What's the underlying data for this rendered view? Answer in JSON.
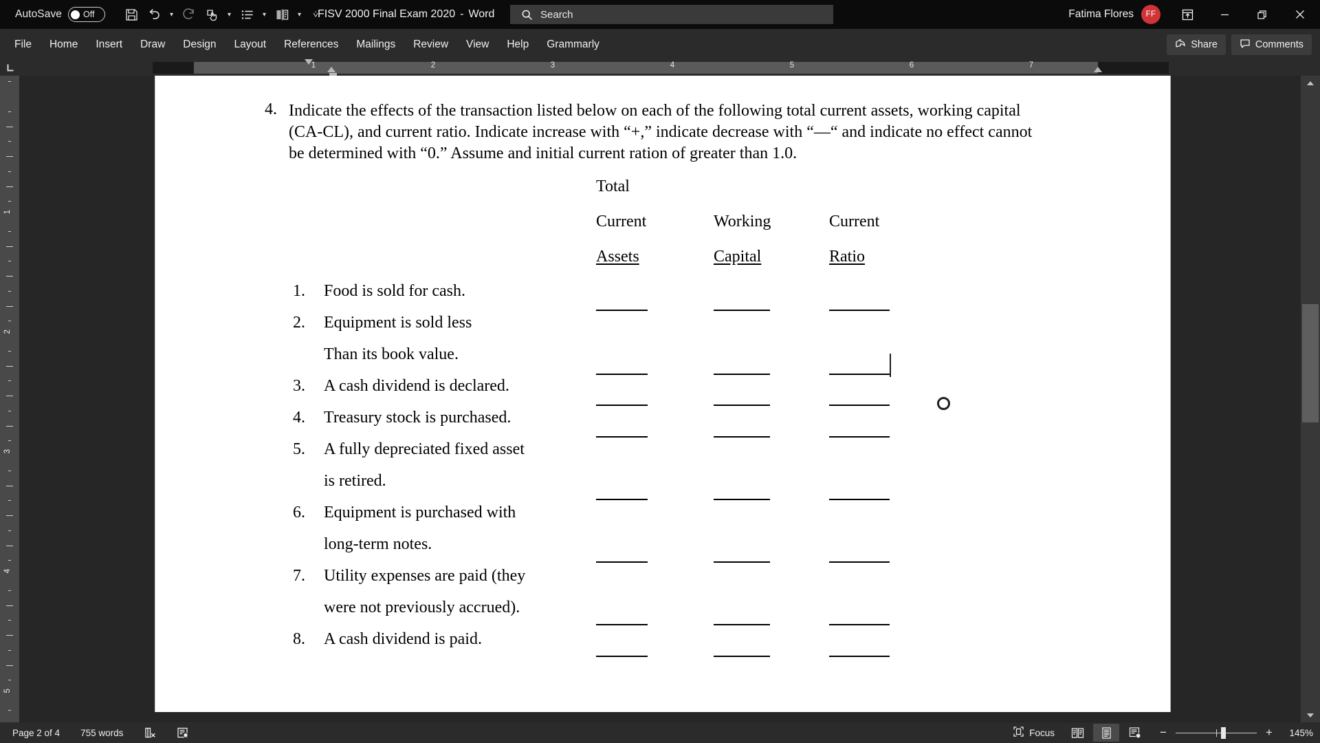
{
  "titlebar": {
    "autosave_label": "AutoSave",
    "autosave_state": "Off",
    "document_title": "FISV 2000 Final Exam 2020",
    "title_separator": "-",
    "app_name": "Word",
    "search_placeholder": "Search",
    "account_name": "Fatima Flores",
    "account_initials": "FF",
    "quick_access": [
      {
        "name": "save-icon",
        "label": "Save"
      },
      {
        "name": "undo-icon",
        "label": "Undo"
      },
      {
        "name": "redo-icon",
        "label": "Redo"
      },
      {
        "name": "touch-mode-icon",
        "label": "Touch/Mouse Mode"
      },
      {
        "name": "bullet-list-icon",
        "label": "Bullets"
      },
      {
        "name": "compare-icon",
        "label": "Compare"
      },
      {
        "name": "customize-qat-icon",
        "label": "Customize Quick Access Toolbar"
      }
    ],
    "window_controls": [
      {
        "name": "ribbon-display-options-icon",
        "label": "Ribbon Display Options"
      },
      {
        "name": "minimize-icon",
        "label": "Minimize"
      },
      {
        "name": "restore-icon",
        "label": "Restore Down"
      },
      {
        "name": "close-icon",
        "label": "Close"
      }
    ]
  },
  "ribbon": {
    "tabs": [
      "File",
      "Home",
      "Insert",
      "Draw",
      "Design",
      "Layout",
      "References",
      "Mailings",
      "Review",
      "View",
      "Help",
      "Grammarly"
    ],
    "share_label": "Share",
    "comments_label": "Comments"
  },
  "ruler": {
    "horizontal_numbers": [
      "1",
      "1",
      "2",
      "3",
      "4",
      "5",
      "6",
      "7"
    ],
    "vertical_numbers": [
      "1",
      "2",
      "3",
      "4",
      "5"
    ]
  },
  "document": {
    "question_number": "4.",
    "question_text": "Indicate the effects of the transaction listed below on each of the following total current assets, working capital (CA-CL), and current ratio. Indicate increase with “+,” indicate decrease with “—“ and indicate no effect cannot be determined with “0.” Assume and initial current ration of greater than 1.0.",
    "column_headers": [
      {
        "line1": "Total",
        "line2": "Current",
        "line3": "Assets"
      },
      {
        "line1": "",
        "line2": "Working",
        "line3": "Capital"
      },
      {
        "line1": "",
        "line2": "Current",
        "line3": "Ratio"
      }
    ],
    "items": [
      {
        "num": "1.",
        "lines": [
          "Food is sold for cash."
        ]
      },
      {
        "num": "2.",
        "lines": [
          "Equipment is sold less",
          "Than its book value."
        ]
      },
      {
        "num": "3.",
        "lines": [
          "A cash dividend is declared."
        ]
      },
      {
        "num": "4.",
        "lines": [
          "Treasury stock is purchased."
        ]
      },
      {
        "num": "5.",
        "lines": [
          "A fully depreciated fixed asset",
          "is retired."
        ]
      },
      {
        "num": "6.",
        "lines": [
          "Equipment is purchased with",
          "long-term notes."
        ]
      },
      {
        "num": "7.",
        "lines": [
          "Utility expenses are paid (they",
          "were not previously accrued)."
        ]
      },
      {
        "num": "8.",
        "lines": [
          "A cash dividend is paid."
        ]
      }
    ]
  },
  "statusbar": {
    "page_label": "Page 2 of 4",
    "word_count": "755 words",
    "proofing_icon": "spelling-check-icon",
    "accessibility_icon": "accessibility-checker-icon",
    "focus_label": "Focus",
    "views": [
      {
        "name": "read-mode-icon",
        "label": "Read Mode",
        "active": false
      },
      {
        "name": "print-layout-icon",
        "label": "Print Layout",
        "active": true
      },
      {
        "name": "web-layout-icon",
        "label": "Web Layout",
        "active": false
      }
    ],
    "zoom_value": "145%",
    "zoom_out_label": "−",
    "zoom_in_label": "+"
  },
  "colors": {
    "titlebar_bg": "#0b0b0b",
    "ribbon_bg": "#2b2b2b",
    "canvas_bg": "#262626",
    "page_bg": "#ffffff",
    "accent_avatar": "#d13438"
  }
}
